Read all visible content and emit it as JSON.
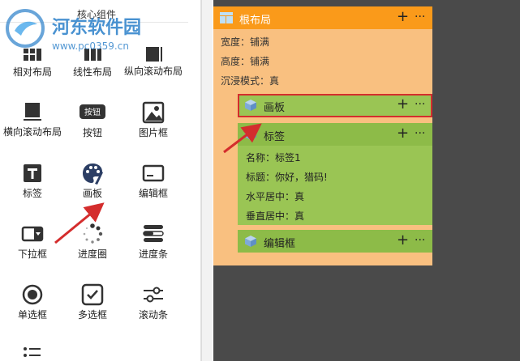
{
  "palette": {
    "title": "核心组件",
    "items": [
      {
        "label": "相对布局",
        "icon": "relative-layout-icon"
      },
      {
        "label": "线性布局",
        "icon": "linear-layout-icon"
      },
      {
        "label": "纵向滚动布局",
        "icon": "vertical-scroll-layout-icon"
      },
      {
        "label": "横向滚动布局",
        "icon": "horizontal-scroll-layout-icon"
      },
      {
        "label": "按钮",
        "icon": "button-icon",
        "badge": "按钮"
      },
      {
        "label": "图片框",
        "icon": "image-icon"
      },
      {
        "label": "标签",
        "icon": "label-icon"
      },
      {
        "label": "画板",
        "icon": "palette-icon"
      },
      {
        "label": "编辑框",
        "icon": "edit-box-icon"
      },
      {
        "label": "下拉框",
        "icon": "dropdown-icon"
      },
      {
        "label": "进度圈",
        "icon": "progress-circle-icon"
      },
      {
        "label": "进度条",
        "icon": "progress-bar-icon"
      },
      {
        "label": "单选框",
        "icon": "radio-icon"
      },
      {
        "label": "多选框",
        "icon": "checkbox-icon"
      },
      {
        "label": "滚动条",
        "icon": "slider-icon"
      },
      {
        "label": "",
        "icon": "list-icon"
      }
    ]
  },
  "watermark": {
    "name": "河东软件园",
    "url": "www.pc0359.cn"
  },
  "canvas": {
    "root": {
      "title": "根布局",
      "plus": "+",
      "more": "···",
      "props": [
        "宽度：铺满",
        "高度：铺满",
        "沉浸模式：真"
      ],
      "children": [
        {
          "title": "画板",
          "plus": "+",
          "more": "···",
          "props": [],
          "selected": true
        },
        {
          "title": "标签",
          "plus": "+",
          "more": "···",
          "props": [
            "名称：标签1",
            "标题：你好，猎码!",
            "水平居中：真",
            "垂直居中：真"
          ]
        },
        {
          "title": "编辑框",
          "plus": "+",
          "more": "···",
          "props": []
        }
      ]
    }
  },
  "colors": {
    "root_header": "#fa9a1a",
    "root_body": "#f9c080",
    "child_body": "#9ac554",
    "canvas_bg": "#4a4a4a",
    "selection": "#d42d2d",
    "arrow": "#d42d2d"
  }
}
